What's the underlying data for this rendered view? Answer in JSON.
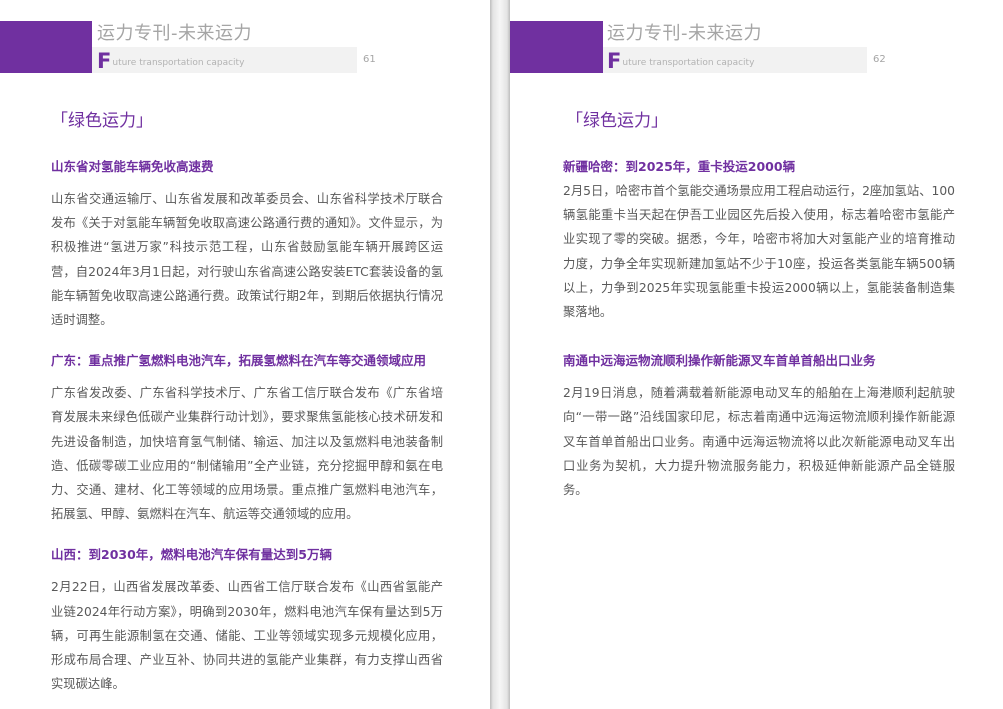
{
  "header": {
    "title": "运力专刊-未来运力",
    "subtitle_initial": "F",
    "subtitle_rest": "uture transportation capacity"
  },
  "pages": [
    {
      "page_number": "61",
      "section": "「绿色运力」",
      "articles": [
        {
          "title": "山东省对氢能车辆免收高速费",
          "body": "山东省交通运输厅、山东省发展和改革委员会、山东省科学技术厅联合发布《关于对氢能车辆暂免收取高速公路通行费的通知》。文件显示，为积极推进“氢进万家”科技示范工程，山东省鼓励氢能车辆开展跨区运营，自2024年3月1日起，对行驶山东省高速公路安装ETC套装设备的氢能车辆暂免收取高速公路通行费。政策试行期2年，到期后依据执行情况适时调整。"
        },
        {
          "title": "广东：重点推广氢燃料电池汽车，拓展氢燃料在汽车等交通领域应用",
          "body": "广东省发改委、广东省科学技术厅、广东省工信厅联合发布《广东省培育发展未来绿色低碳产业集群行动计划》，要求聚焦氢能核心技术研发和先进设备制造，加快培育氢气制储、输运、加注以及氢燃料电池装备制造、低碳零碳工业应用的“制储输用”全产业链，充分挖掘甲醇和氨在电力、交通、建材、化工等领域的应用场景。重点推广氢燃料电池汽车，拓展氢、甲醇、氨燃料在汽车、航运等交通领域的应用。"
        },
        {
          "title": "山西：到2030年，燃料电池汽车保有量达到5万辆",
          "body": "2月22日，山西省发展改革委、山西省工信厅联合发布《山西省氢能产业链2024年行动方案》，明确到2030年，燃料电池汽车保有量达到5万辆，可再生能源制氢在交通、储能、工业等领域实现多元规模化应用，形成布局合理、产业互补、协同共进的氢能产业集群，有力支撑山西省实现碳达峰。"
        }
      ]
    },
    {
      "page_number": "62",
      "section": "「绿色运力」",
      "articles": [
        {
          "title": "新疆哈密：到2025年，重卡投运2000辆",
          "body": "2月5日，哈密市首个氢能交通场景应用工程启动运行，2座加氢站、100辆氢能重卡当天起在伊吾工业园区先后投入使用，标志着哈密市氢能产业实现了零的突破。据悉，今年，哈密市将加大对氢能产业的培育推动力度，力争全年实现新建加氢站不少于10座，投运各类氢能车辆500辆以上，力争到2025年实现氢能重卡投运2000辆以上，氢能装备制造集聚落地。"
        },
        {
          "title": "南通中远海运物流顺利操作新能源叉车首单首船出口业务",
          "body": "2月19日消息，随着满载着新能源电动叉车的船舶在上海港顺利起航驶向“一带一路”沿线国家印尼，标志着南通中远海运物流顺利操作新能源叉车首单首船出口业务。南通中远海运物流将以此次新能源电动叉车出口业务为契机，大力提升物流服务能力，积极延伸新能源产品全链服务。"
        }
      ]
    }
  ]
}
